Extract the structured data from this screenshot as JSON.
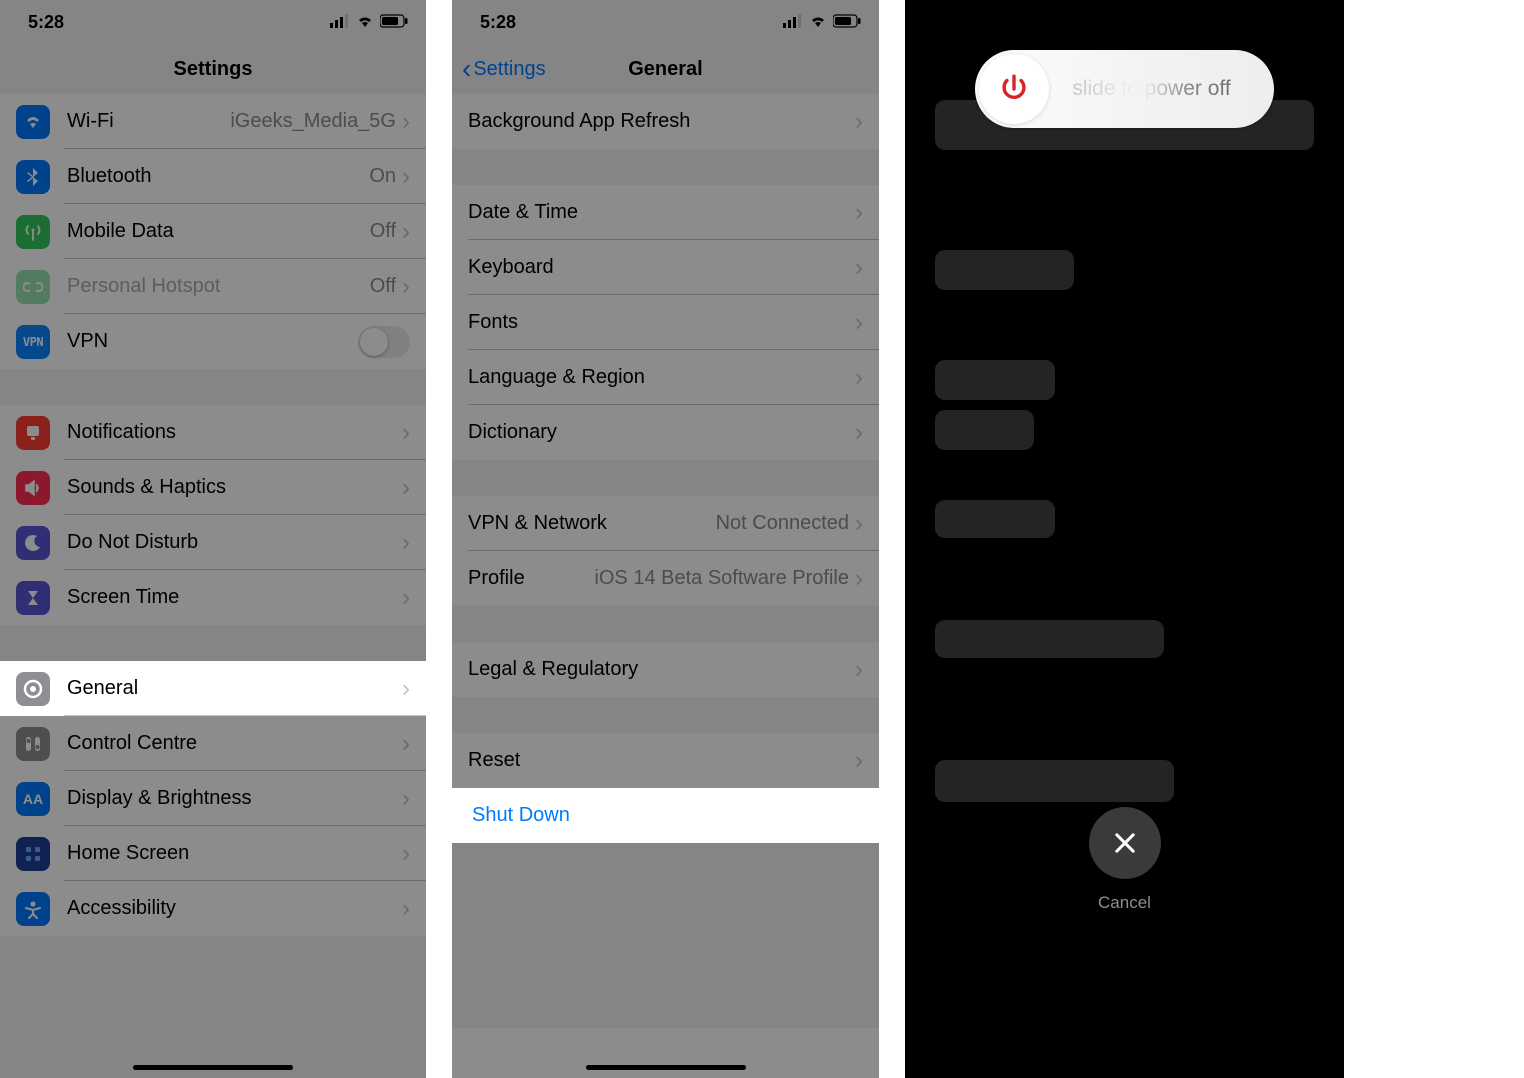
{
  "status": {
    "time": "5:28"
  },
  "panel1": {
    "title": "Settings",
    "rows": [
      {
        "label": "Wi-Fi",
        "value": "iGeeks_Media_5G",
        "icon": "wifi",
        "bg": "bg-blue"
      },
      {
        "label": "Bluetooth",
        "value": "On",
        "icon": "bluetooth",
        "bg": "bg-blue"
      },
      {
        "label": "Mobile Data",
        "value": "Off",
        "icon": "antenna",
        "bg": "bg-green"
      },
      {
        "label": "Personal Hotspot",
        "value": "Off",
        "icon": "hotspot",
        "bg": "bg-green",
        "disabled": true
      },
      {
        "label": "VPN",
        "icon": "vpn",
        "bg": "bg-bluealt",
        "toggle": true
      }
    ],
    "rows2": [
      {
        "label": "Notifications",
        "icon": "bell",
        "bg": "bg-red"
      },
      {
        "label": "Sounds & Haptics",
        "icon": "speaker",
        "bg": "bg-pink"
      },
      {
        "label": "Do Not Disturb",
        "icon": "moon",
        "bg": "bg-purple"
      },
      {
        "label": "Screen Time",
        "icon": "hourglass",
        "bg": "bg-purple"
      }
    ],
    "rows3_highlight": {
      "label": "General",
      "icon": "gear",
      "bg": "bg-gray"
    },
    "rows3_rest": [
      {
        "label": "Control Centre",
        "icon": "sliders",
        "bg": "bg-gray"
      },
      {
        "label": "Display & Brightness",
        "icon": "aa",
        "bg": "bg-blue"
      },
      {
        "label": "Home Screen",
        "icon": "grid",
        "bg": "bg-navy"
      },
      {
        "label": "Accessibility",
        "icon": "figure",
        "bg": "bg-accessblue"
      }
    ]
  },
  "panel2": {
    "back_label": "Settings",
    "title": "General",
    "g1": [
      {
        "label": "Background App Refresh"
      }
    ],
    "g2": [
      {
        "label": "Date & Time"
      },
      {
        "label": "Keyboard"
      },
      {
        "label": "Fonts"
      },
      {
        "label": "Language & Region"
      },
      {
        "label": "Dictionary"
      }
    ],
    "g3": [
      {
        "label": "VPN & Network",
        "value": "Not Connected"
      },
      {
        "label": "Profile",
        "value": "iOS 14 Beta Software Profile"
      }
    ],
    "g4": [
      {
        "label": "Legal & Regulatory"
      }
    ],
    "g5": [
      {
        "label": "Reset"
      }
    ],
    "shutdown_label": "Shut Down"
  },
  "panel3": {
    "slide_text": "slide to power off",
    "cancel_label": "Cancel"
  }
}
